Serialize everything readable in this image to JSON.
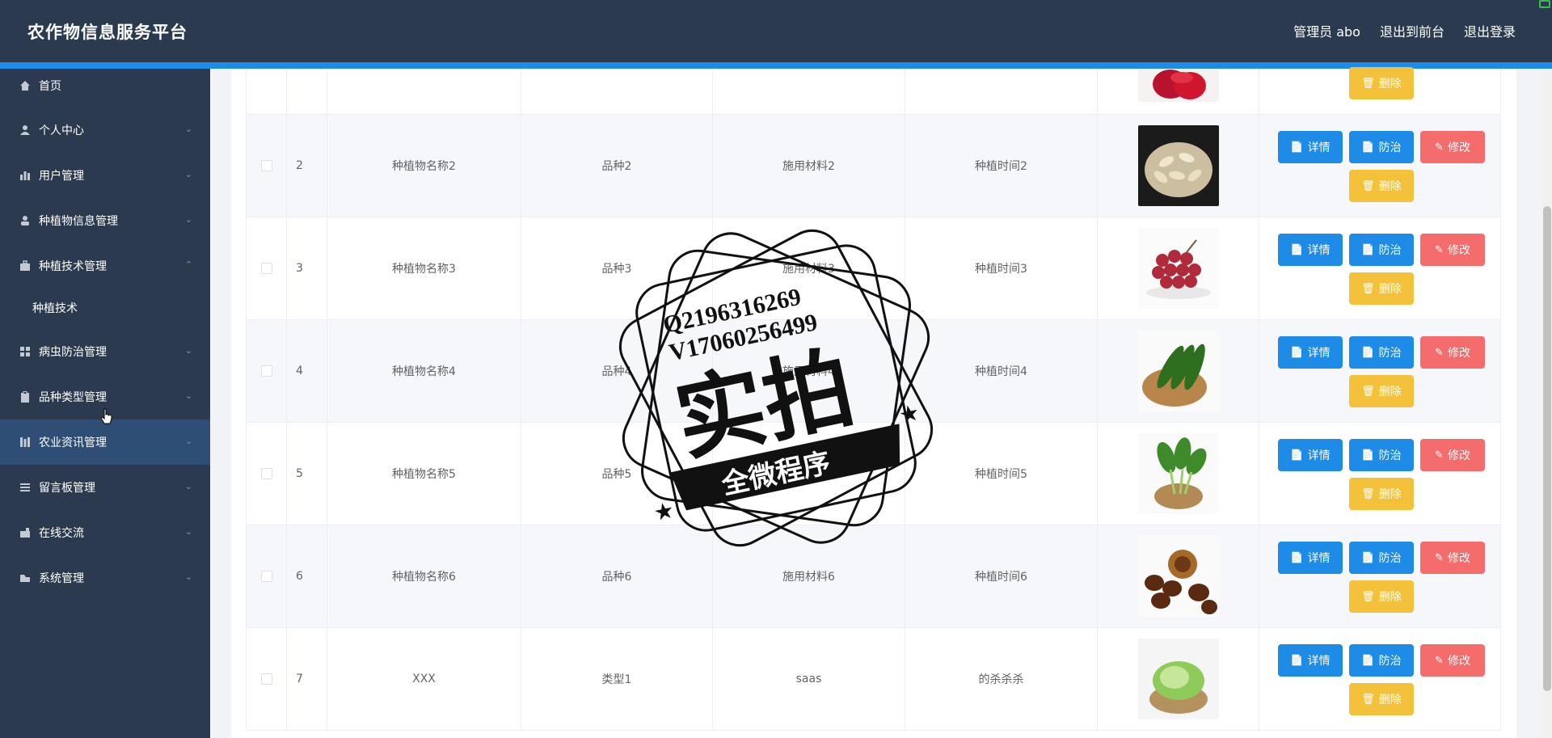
{
  "header": {
    "title": "农作物信息服务平台",
    "admin_label": "管理员 abo",
    "to_front_label": "退出到前台",
    "logout_label": "退出登录"
  },
  "sidebar": {
    "items": [
      {
        "label": "首页",
        "icon": "home-icon"
      },
      {
        "label": "个人中心",
        "icon": "user-icon"
      },
      {
        "label": "用户管理",
        "icon": "chart-icon"
      },
      {
        "label": "种植物信息管理",
        "icon": "person-icon"
      },
      {
        "label": "种植技术管理",
        "icon": "briefcase-icon"
      },
      {
        "label": "病虫防治管理",
        "icon": "grid-icon"
      },
      {
        "label": "品种类型管理",
        "icon": "clipboard-icon"
      },
      {
        "label": "农业资讯管理",
        "icon": "bar-icon"
      },
      {
        "label": "留言板管理",
        "icon": "list-icon"
      },
      {
        "label": "在线交流",
        "icon": "chat-icon"
      },
      {
        "label": "系统管理",
        "icon": "settings-icon"
      }
    ],
    "submenu": {
      "label": "种植技术"
    }
  },
  "table": {
    "rows": [
      {
        "index": "2",
        "name": "种植物名称2",
        "variety": "品种2",
        "material": "施用材料2",
        "time": "种植时间2",
        "image": "pumpkin-seeds"
      },
      {
        "index": "3",
        "name": "种植物名称3",
        "variety": "品种3",
        "material": "施用材料3",
        "time": "种植时间3",
        "image": "grapes"
      },
      {
        "index": "4",
        "name": "种植物名称4",
        "variety": "品种4",
        "material": "施用材料4",
        "time": "种植时间4",
        "image": "cucumbers"
      },
      {
        "index": "5",
        "name": "种植物名称5",
        "variety": "品种5",
        "material": "施用材料5",
        "time": "种植时间5",
        "image": "greens"
      },
      {
        "index": "6",
        "name": "种植物名称6",
        "variety": "品种6",
        "material": "施用材料6",
        "time": "种植时间6",
        "image": "chestnuts"
      },
      {
        "index": "7",
        "name": "XXX",
        "variety": "类型1",
        "material": "saas",
        "time": "的杀杀杀",
        "image": "lettuce"
      }
    ],
    "buttons": {
      "detail": "详情",
      "prevent": "防治",
      "edit": "修改",
      "delete": "删除"
    }
  },
  "watermark": {
    "line1": "Q2196316269",
    "line2": "V17060256499",
    "main": "实拍",
    "banner": "全微程序"
  },
  "colors": {
    "header_bg": "#2b3a4e",
    "accent": "#1e8be6",
    "danger": "#f56c6c",
    "warning": "#f4c13b"
  }
}
